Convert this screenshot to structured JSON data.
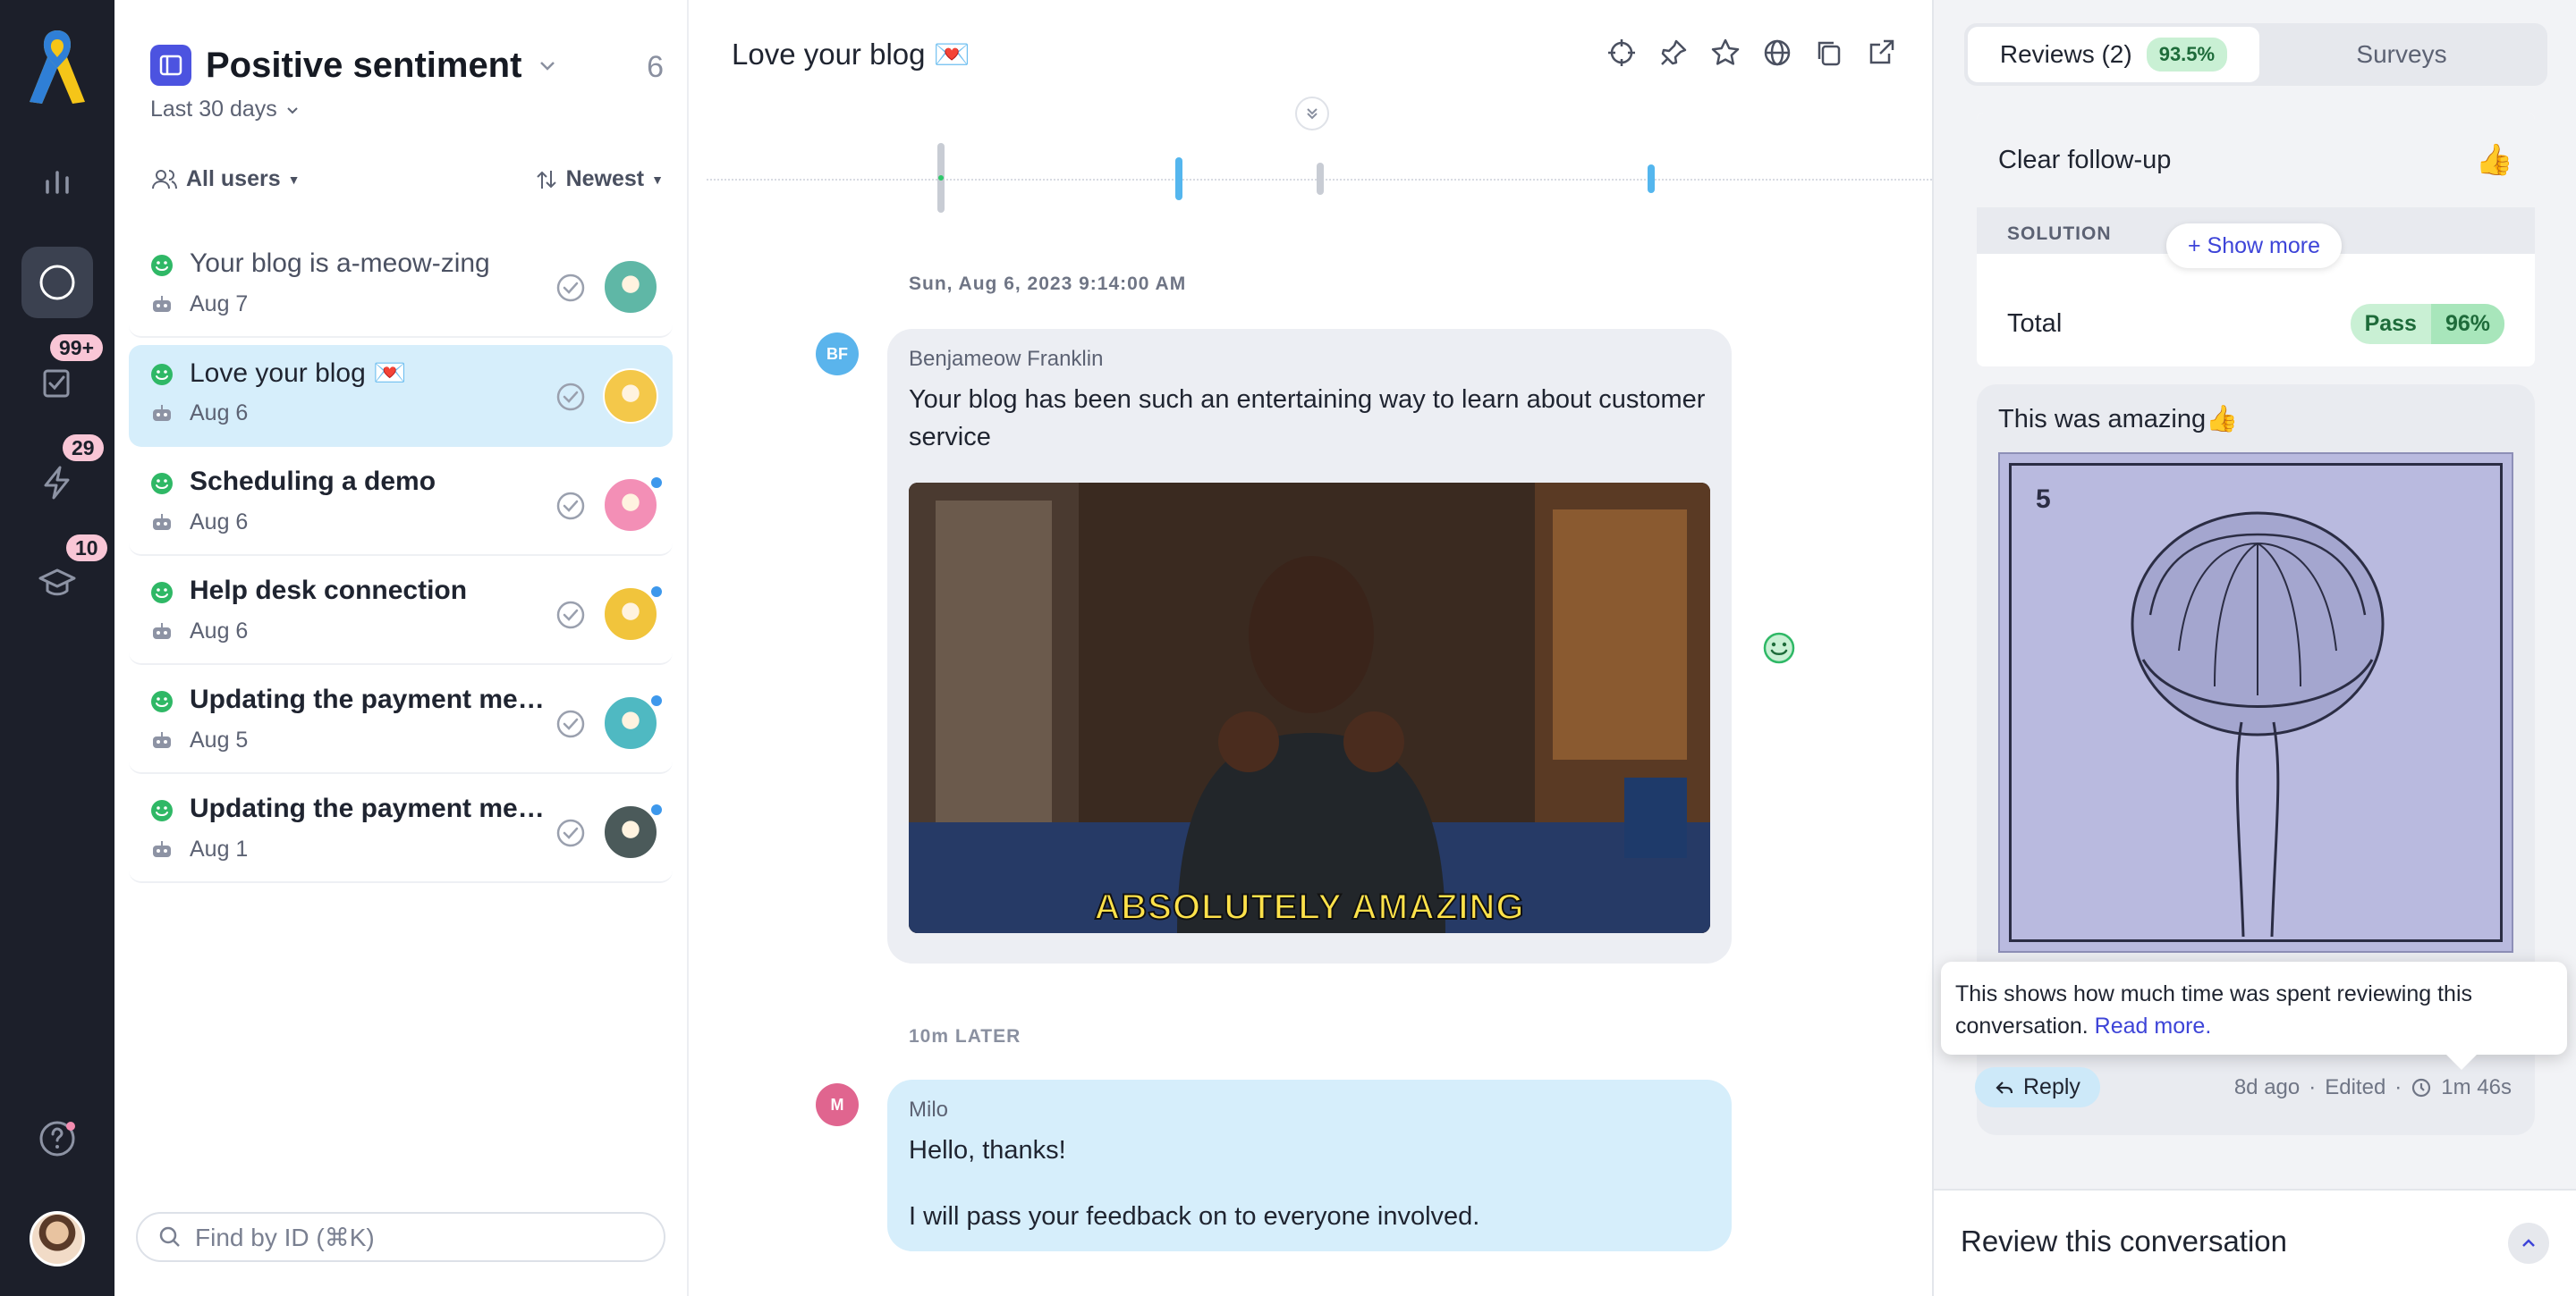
{
  "rail": {
    "badges": {
      "tasks": "99+",
      "actions": "29",
      "learn": "10"
    }
  },
  "list": {
    "title": "Positive sentiment",
    "count": "6",
    "range": "Last 30 days",
    "filter_users": "All users",
    "sort": "Newest",
    "search_placeholder": "Find by ID (⌘K)",
    "items": [
      {
        "title": "Your blog is a-meow-zing",
        "date": "Aug 7",
        "weight": "dim",
        "avatar_color": "#5fb7a6",
        "unread": false
      },
      {
        "title": "Love your blog 💌",
        "date": "Aug 6",
        "weight": "normal",
        "avatar_color": "#f4c84a",
        "unread": false
      },
      {
        "title": "Scheduling a demo",
        "date": "Aug 6",
        "weight": "bold",
        "avatar_color": "#f38fb6",
        "unread": true
      },
      {
        "title": "Help desk connection",
        "date": "Aug 6",
        "weight": "bold",
        "avatar_color": "#f1c43c",
        "unread": true
      },
      {
        "title": "Updating the payment method",
        "date": "Aug 5",
        "weight": "bold",
        "avatar_color": "#4fb9c2",
        "unread": true
      },
      {
        "title": "Updating the payment method",
        "date": "Aug 1",
        "weight": "bold",
        "avatar_color": "#4b5a5a",
        "unread": true
      }
    ]
  },
  "conversation": {
    "title": "Love your blog 💌",
    "timestamp": "Sun, Aug 6, 2023 9:14:00 AM",
    "later": "10m LATER",
    "messages": [
      {
        "initials": "BF",
        "author": "Benjameow Franklin",
        "text": "Your blog has been such an entertaining way to learn about customer service",
        "gif_caption": "ABSOLUTELY AMAZING"
      },
      {
        "initials": "M",
        "author": "Milo",
        "line1": "Hello, thanks!",
        "line2": "I will pass your feedback on to everyone involved."
      }
    ]
  },
  "review": {
    "tab_reviews": "Reviews (2)",
    "tab_reviews_score": "93.5%",
    "tab_surveys": "Surveys",
    "criterion": "Clear follow-up",
    "criterion_icon": "👍",
    "section": "SOLUTION",
    "show_more": "+ Show more",
    "total_label": "Total",
    "total_result": "Pass",
    "total_score": "96%",
    "comment": "This was amazing👍",
    "sketch_number": "5",
    "tooltip_text": "This shows how much time was spent reviewing this conversation.",
    "tooltip_link": "Read more.",
    "reply": "Reply",
    "meta_time": "8d ago",
    "meta_edited": "Edited",
    "meta_duration": "1m 46s",
    "footer": "Review this conversation"
  }
}
